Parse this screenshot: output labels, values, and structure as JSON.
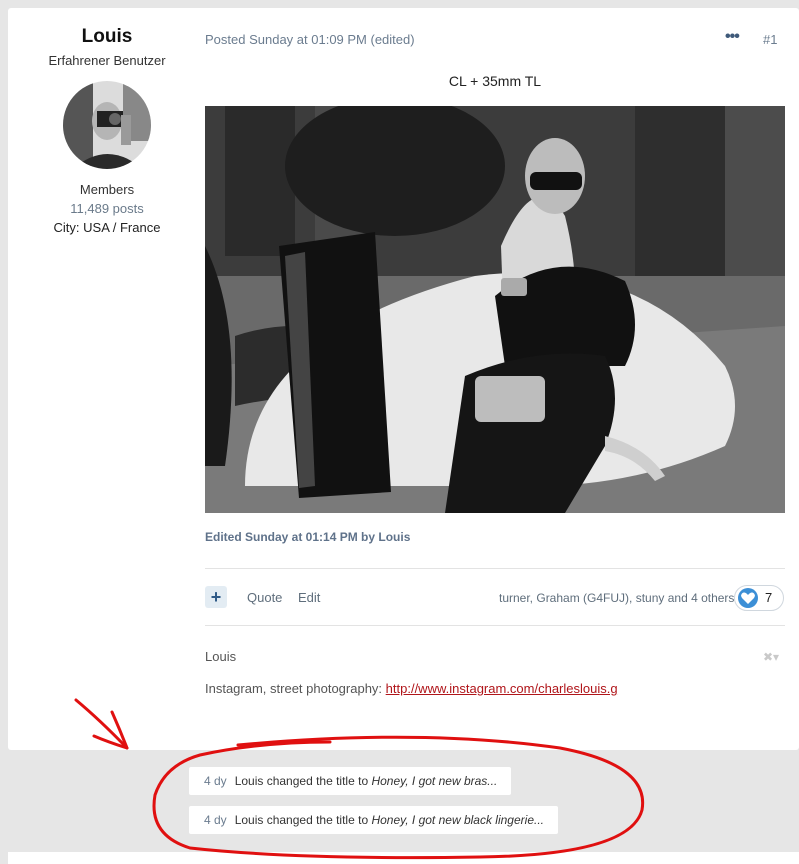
{
  "author": {
    "name": "Louis",
    "rank": "Erfahrener Benutzer",
    "group": "Members",
    "posts": "11,489 posts",
    "city": "City: USA / France"
  },
  "post": {
    "meta": "Posted Sunday at 01:09 PM (edited)",
    "more_icon": "•••",
    "number": "#1",
    "title": "CL + 35mm TL",
    "edited": "Edited Sunday at 01:14 PM by Louis"
  },
  "actions": {
    "react_plus": "+",
    "quote": "Quote",
    "edit": "Edit",
    "reacted_users": "turner, Graham (G4FUJ), stuny and 4 others",
    "reaction_count": "7",
    "reaction_icon": "heart-icon"
  },
  "signature": {
    "name": "Louis",
    "close_icon": "✖▾",
    "text": "Instagram, street photography: ",
    "link": "http://www.instagram.com/charleslouis.g"
  },
  "events": [
    {
      "time": "4 dy",
      "text": "Louis changed the title to ",
      "new_title": "Honey, I got new bras..."
    },
    {
      "time": "4 dy",
      "text": "Louis changed the title to ",
      "new_title": "Honey, I got new black lingerie..."
    }
  ],
  "colors": {
    "annotation_red": "#e01010",
    "link_red": "#b0151a",
    "accent_blue": "#3c8fd6"
  }
}
